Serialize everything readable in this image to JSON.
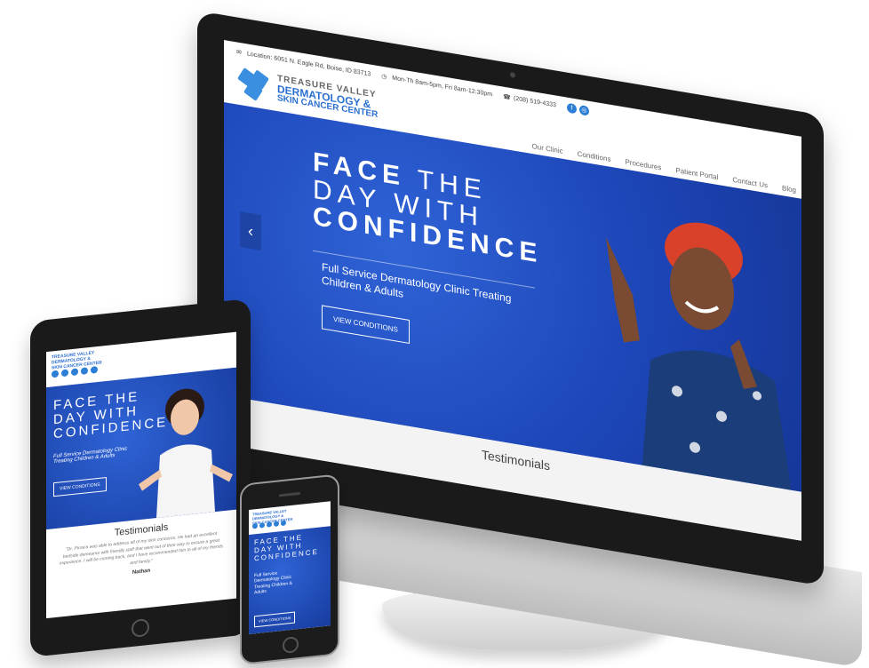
{
  "site": {
    "brand": {
      "line1": "TREASURE VALLEY",
      "line2": "DERMATOLOGY &",
      "line3": "SKIN CANCER CENTER"
    },
    "topbar": {
      "location_label": "Location:",
      "location_value": "6051 N. Eagle Rd, Boise, ID 83713",
      "hours": "Mon-Th 8am-5pm, Fri 8am-12:30pm",
      "phone": "(208) 519-4333"
    },
    "nav": [
      "Our Clinic",
      "Conditions",
      "Procedures",
      "Patient Portal",
      "Contact Us",
      "Blog"
    ],
    "hero": {
      "title_line1_bold": "FACE",
      "title_line1_rest": " THE",
      "title_line2": "DAY WITH",
      "title_line3": "CONFIDENCE",
      "subtitle": "Full Service Dermatology Clinic Treating Children & Adults",
      "button": "VIEW CONDITIONS",
      "prev_arrow": "‹"
    },
    "testimonials": {
      "heading": "Testimonials",
      "quote": "\"Dr. Pirraca was able to address all of my skin concerns. He had an excellent bedside demeanor with friendly staff that went out of their way to ensure a great experience. I will be coming back, and I have recommended him to all of my friends and family.\"",
      "author": "Nathan"
    }
  },
  "tablet": {
    "hero_title": "FACE THE DAY WITH CONFIDENCE",
    "subtitle": "Full Service Dermatology Clinic Treating Children & Adults",
    "button": "VIEW CONDITIONS"
  },
  "phone": {
    "hero_title": "FACE THE DAY WITH CONFIDENCE",
    "subtitle": "Full Service Dermatology Clinic Treating Children & Adults",
    "button": "VIEW CONDITIONS"
  },
  "colors": {
    "brand_blue": "#2a6fd1",
    "hero_blue": "#1d46b8",
    "social_blue": "#2d7fd6"
  }
}
